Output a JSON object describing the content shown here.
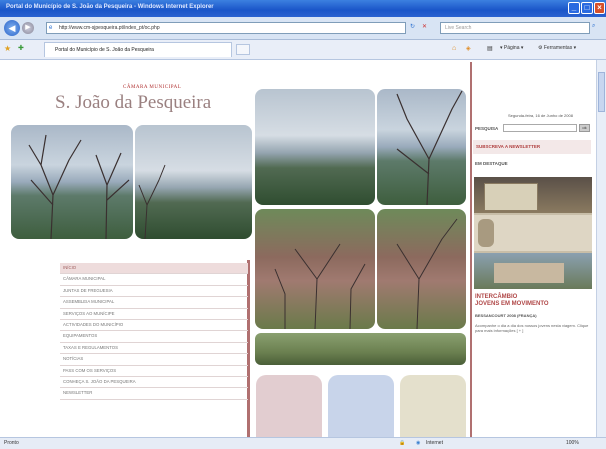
{
  "window": {
    "title": "Portal do Município de S. João da Pesqueira - Windows Internet Explorer"
  },
  "browser": {
    "address": "http://www.cm-sjpesqueira.pt/index_pt/oc.php",
    "search_placeholder": "Live Search",
    "tab_title": "Portal do Município de S. João da Pesqueira",
    "tools": {
      "page": "Página",
      "tools": "Ferramentas"
    }
  },
  "site": {
    "logo_small": "CÂMARA MUNICIPAL",
    "logo_big": "S. João da Pesqueira",
    "menu": [
      "Início",
      "Câmara Municipal",
      "Juntas de Freguesia",
      "Assembleia Municipal",
      "Serviços ao Munícipe",
      "Actividades do Município",
      "Equipamentos",
      "Taxas e Regulamentos",
      "Notícias",
      "Pass com os Serviços",
      "Conheça S. João da Pesqueira",
      "Newsletter"
    ],
    "date": "Segunda-feira, 16 de Junho de 2008",
    "search_label": "PESQUISA",
    "search_button": "ok",
    "newsletter": "SUBSCREVA A NEWSLETTER",
    "destaque": "EM DESTAQUE",
    "intercambio": "INTERCÂMBIO",
    "jovens": "JOVENS EM MOVIMENTO",
    "besancourt": "BESSANCOURT 2008 (FRANÇA)",
    "blurb": "Acompanhe o dia a dia dos nossos jovens nesta viagem. Clique para mais informações [ + ]"
  },
  "status": {
    "left": "Pronto",
    "zone": "Internet",
    "zoom": "100%"
  },
  "colors": {
    "accent": "#b07070",
    "titlebar": "#1a55c8"
  }
}
